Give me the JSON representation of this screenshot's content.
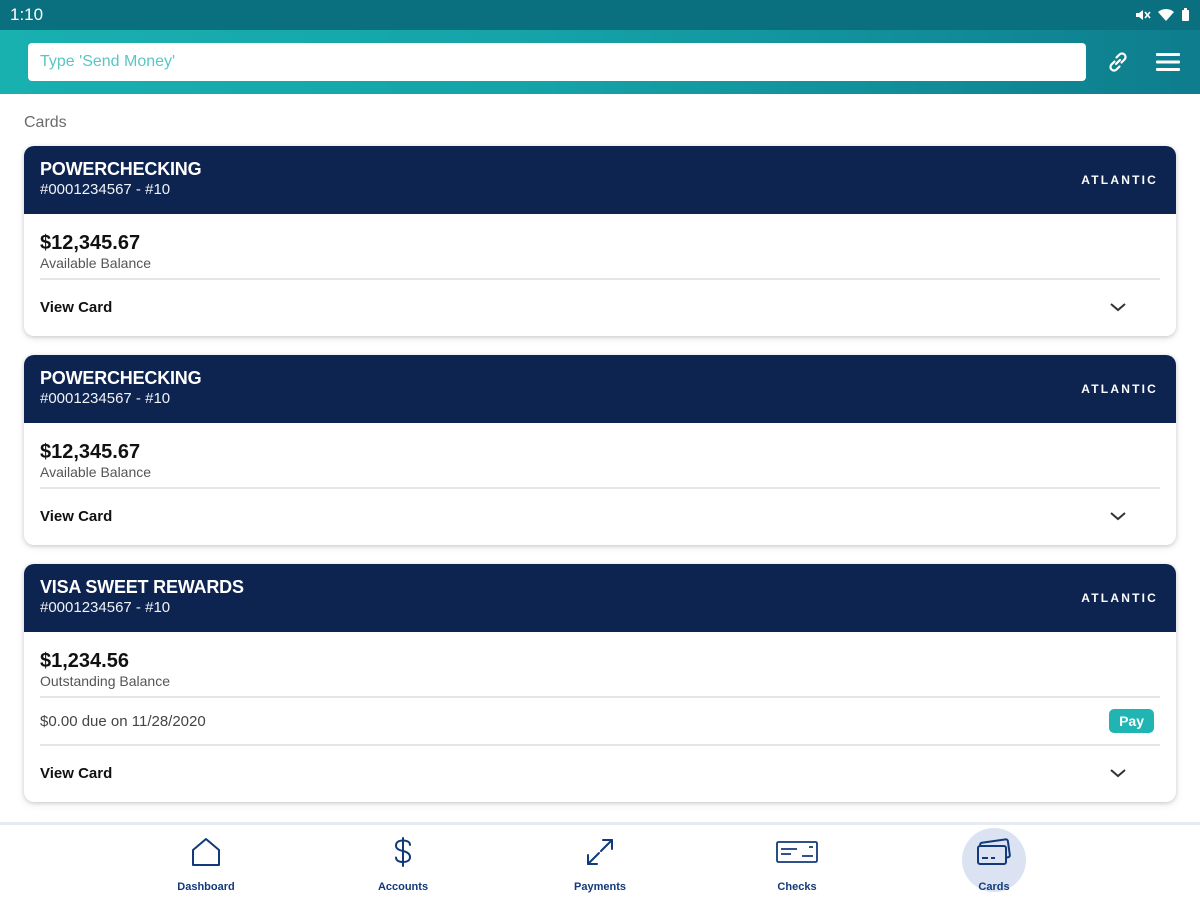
{
  "status": {
    "time": "1:10"
  },
  "search": {
    "placeholder": "Type 'Send Money'"
  },
  "section": {
    "title": "Cards"
  },
  "cards": [
    {
      "name": "POWERCHECKING",
      "number": "#0001234567 - #10",
      "brand": "ATLANTIC",
      "amount": "$12,345.67",
      "amount_label": "Available Balance",
      "view_label": "View Card"
    },
    {
      "name": "POWERCHECKING",
      "number": "#0001234567 - #10",
      "brand": "ATLANTIC",
      "amount": "$12,345.67",
      "amount_label": "Available Balance",
      "view_label": "View Card"
    },
    {
      "name": "VISA SWEET REWARDS",
      "number": "#0001234567 - #10",
      "brand": "ATLANTIC",
      "amount": "$1,234.56",
      "amount_label": "Outstanding Balance",
      "due_text": "$0.00 due on 11/28/2020",
      "pay_label": "Pay",
      "view_label": "View Card"
    }
  ],
  "nav": [
    {
      "label": "Dashboard",
      "icon": "home-icon"
    },
    {
      "label": "Accounts",
      "icon": "dollar-icon"
    },
    {
      "label": "Payments",
      "icon": "transfer-arrows-icon"
    },
    {
      "label": "Checks",
      "icon": "check-icon"
    },
    {
      "label": "Cards",
      "icon": "credit-card-icon",
      "active": true
    }
  ],
  "colors": {
    "header_start": "#19b0b0",
    "header_end": "#0e7d8d",
    "card_header": "#0d2350",
    "accent": "#20b5b2",
    "nav_text": "#123a7a",
    "nav_active_bg": "#dbe2f2"
  }
}
